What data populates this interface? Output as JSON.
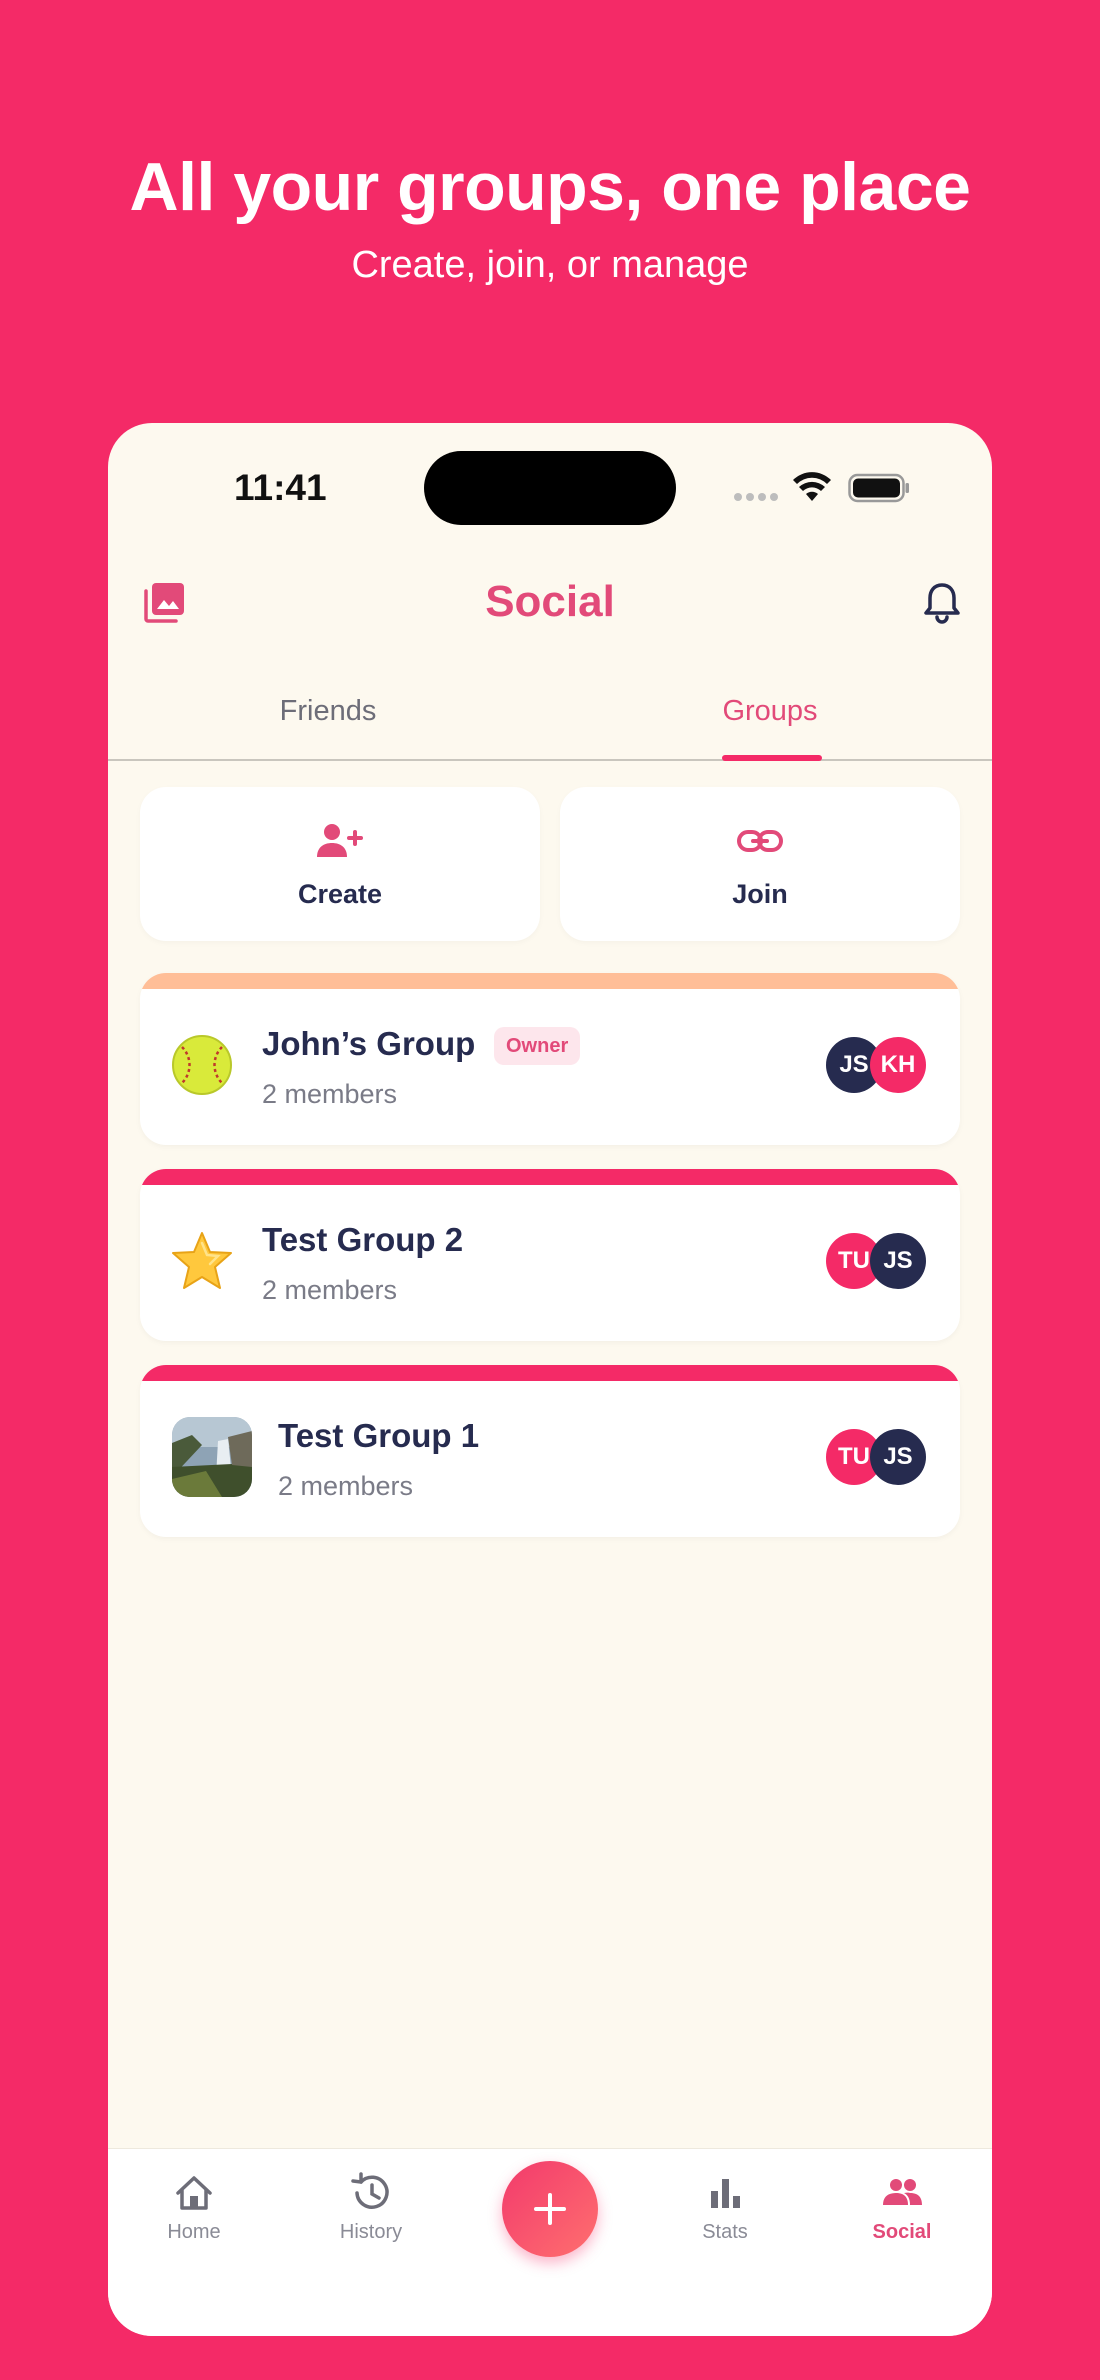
{
  "hero": {
    "title": "All your groups, one place",
    "subtitle": "Create, join, or manage"
  },
  "status_bar": {
    "time": "11:41"
  },
  "header": {
    "title": "Social",
    "left_icon": "gallery-icon",
    "right_icon": "bell-icon"
  },
  "tabs": [
    {
      "label": "Friends",
      "selected": false
    },
    {
      "label": "Groups",
      "selected": true
    }
  ],
  "actions": [
    {
      "label": "Create",
      "icon": "add-person-icon"
    },
    {
      "label": "Join",
      "icon": "link-icon"
    }
  ],
  "groups": [
    {
      "name": "John’s Group",
      "members": "2 members",
      "badge": "Owner",
      "icon": "softball-emoji",
      "stripe_color": "#FFBE97",
      "avatars": [
        {
          "initials": "JS",
          "color": "#262B4F"
        },
        {
          "initials": "KH",
          "color": "#F42A67"
        }
      ]
    },
    {
      "name": "Test Group 2",
      "members": "2 members",
      "icon": "star-emoji",
      "stripe_color": "#F42A67",
      "avatars": [
        {
          "initials": "TU",
          "color": "#F42A67"
        },
        {
          "initials": "JS",
          "color": "#262B4F"
        }
      ]
    },
    {
      "name": "Test Group 1",
      "members": "2 members",
      "icon": "waterfall-photo",
      "stripe_color": "#F42A67",
      "avatars": [
        {
          "initials": "TU",
          "color": "#F42A67"
        },
        {
          "initials": "JS",
          "color": "#262B4F"
        }
      ]
    }
  ],
  "bottom_nav": [
    {
      "label": "Home",
      "icon": "home-icon",
      "active": false
    },
    {
      "label": "History",
      "icon": "history-icon",
      "active": false
    },
    {
      "label": "",
      "icon": "plus-icon",
      "active": false
    },
    {
      "label": "Stats",
      "icon": "bar-chart-icon",
      "active": false
    },
    {
      "label": "Social",
      "icon": "people-icon",
      "active": true
    }
  ],
  "colors": {
    "brand": "#F42A67",
    "accent_text": "#E24A79",
    "navy": "#262B4F",
    "background": "#FDF9EF"
  }
}
